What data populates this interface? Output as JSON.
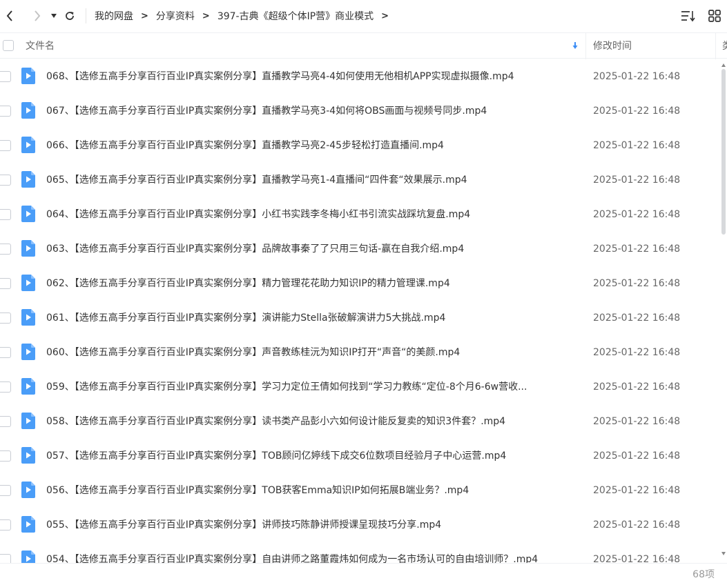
{
  "toolbar": {
    "breadcrumb": [
      "我的网盘",
      "分享资料",
      "397-古典《超级个体IP营》商业模式"
    ],
    "crumb_separator": ">"
  },
  "header": {
    "name_label": "文件名",
    "time_label": "修改时间",
    "type_label": "类"
  },
  "files": [
    {
      "name": "068、【选修五高手分享百行百业IP真实案例分享】直播教学马亮4-4如何使用无他相机APP实现虚拟摄像.mp4",
      "time": "2025-01-22 16:48"
    },
    {
      "name": "067、【选修五高手分享百行百业IP真实案例分享】直播教学马亮3-4如何将OBS画面与视频号同步.mp4",
      "time": "2025-01-22 16:48"
    },
    {
      "name": "066、【选修五高手分享百行百业IP真实案例分享】直播教学马亮2-45步轻松打造直播间.mp4",
      "time": "2025-01-22 16:48"
    },
    {
      "name": "065、【选修五高手分享百行百业IP真实案例分享】直播教学马亮1-4直播间“四件套“效果展示.mp4",
      "time": "2025-01-22 16:48"
    },
    {
      "name": "064、【选修五高手分享百行百业IP真实案例分享】小红书实践李冬梅小红书引流实战踩坑复盘.mp4",
      "time": "2025-01-22 16:48"
    },
    {
      "name": "063、【选修五高手分享百行百业IP真实案例分享】品牌故事秦了了只用三句话-赢在自我介绍.mp4",
      "time": "2025-01-22 16:48"
    },
    {
      "name": "062、【选修五高手分享百行百业IP真实案例分享】精力管理花花助力知识IP的精力管理课.mp4",
      "time": "2025-01-22 16:48"
    },
    {
      "name": "061、【选修五高手分享百行百业IP真实案例分享】演讲能力Stella张破解演讲力5大挑战.mp4",
      "time": "2025-01-22 16:48"
    },
    {
      "name": "060、【选修五高手分享百行百业IP真实案例分享】声音教练桂沅为知识IP打开“声音“的美颜.mp4",
      "time": "2025-01-22 16:48"
    },
    {
      "name": "059、【选修五高手分享百行百业IP真实案例分享】学习力定位王倩如何找到“学习力教练“定位-8个月6-6w营收...",
      "time": "2025-01-22 16:48"
    },
    {
      "name": "058、【选修五高手分享百行百业IP真实案例分享】读书类产品彭小六如何设计能反复卖的知识3件套？.mp4",
      "time": "2025-01-22 16:48"
    },
    {
      "name": "057、【选修五高手分享百行百业IP真实案例分享】TOB顾问亿婷线下成交6位数项目经验月子中心运营.mp4",
      "time": "2025-01-22 16:48"
    },
    {
      "name": "056、【选修五高手分享百行百业IP真实案例分享】TOB获客Emma知识IP如何拓展B端业务？.mp4",
      "time": "2025-01-22 16:48"
    },
    {
      "name": "055、【选修五高手分享百行百业IP真实案例分享】讲师技巧陈静讲师授课呈现技巧分享.mp4",
      "time": "2025-01-22 16:48"
    },
    {
      "name": "054、【选修五高手分享百行百业IP真实案例分享】自由讲师之路董霞炜如何成为一名市场认可的自由培训师？.mp4",
      "time": "2025-01-22 16:48"
    }
  ],
  "footer": {
    "count": "68项"
  },
  "colors": {
    "file_icon": "#4a9df8",
    "icon_gray": "#333333"
  }
}
